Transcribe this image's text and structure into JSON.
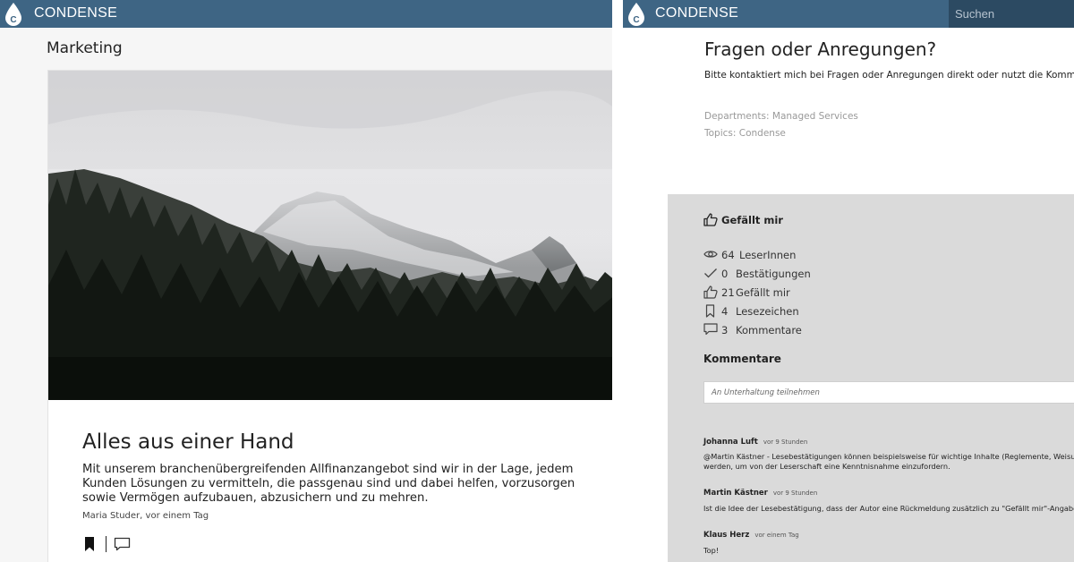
{
  "app": {
    "brand": "CONDENSE"
  },
  "left": {
    "section_title": "Marketing",
    "post": {
      "title": "Alles aus einer Hand",
      "text": "Mit unserem branchenübergreifenden Allfinanzangebot sind wir in der Lage, jedem Kunden Lösungen zu vermitteln, die passgenau sind und dabei helfen, vorzusorgen sowie Vermögen aufzubauen, abzusichern und zu mehren.",
      "meta": "Maria Studer, vor einem Tag"
    }
  },
  "right": {
    "search_placeholder": "Suchen",
    "article": {
      "title": "Fragen oder Anregungen?",
      "text": "Bitte kontaktiert mich bei Fragen oder Anregungen direkt oder nutzt die Kommentarfunktion.",
      "departments": "Departments: Managed Services",
      "topics": "Topics: Condense"
    },
    "like_label": "Gefällt mir",
    "stats": [
      {
        "icon": "eye-icon",
        "count": "64",
        "label": "LeserInnen"
      },
      {
        "icon": "check-icon",
        "count": "0",
        "label": "Bestätigungen"
      },
      {
        "icon": "thumbs-up-icon",
        "count": "21",
        "label": "Gefällt mir"
      },
      {
        "icon": "bookmark-icon",
        "count": "4",
        "label": "Lesezeichen"
      },
      {
        "icon": "comment-icon",
        "count": "3",
        "label": "Kommentare"
      }
    ],
    "comments_heading": "Kommentare",
    "comment_placeholder": "An Unterhaltung teilnehmen",
    "comments": [
      {
        "author": "Johanna Luft",
        "time": "vor 9 Stunden",
        "line1": "@Martin Kästner - Lesebestätigungen können beispielsweise für wichtige Inhalte (Reglemente, Weisungen etc.) verwendet",
        "line2": "werden, um von der Leserschaft eine Kenntnisnahme einzufordern."
      },
      {
        "author": "Martin Kästner",
        "time": "vor 9 Stunden",
        "line1": "Ist die Idee der Lesebestätigung, dass der Autor eine Rückmeldung zusätzlich zu \"Gefällt mir\"-Angaben erhält?"
      },
      {
        "author": "Klaus Herz",
        "time": "vor einem Tag",
        "line1": "Top!"
      }
    ]
  },
  "colors": {
    "topbar": "#3e6584",
    "search_bg": "#2c4a62",
    "panel_grey": "#dadada"
  }
}
